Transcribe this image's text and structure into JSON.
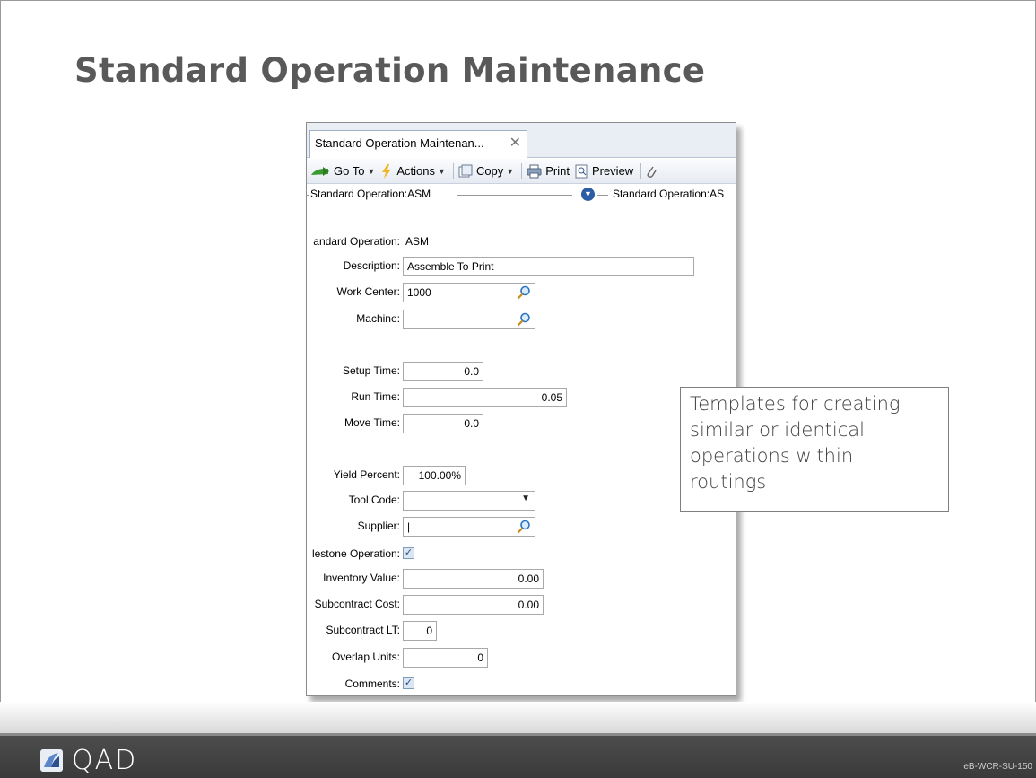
{
  "slide": {
    "title": "Standard Operation Maintenance",
    "callout": [
      "Templates for creating",
      "similar or identical",
      "operations within",
      "routings"
    ],
    "logo_text": "QAD",
    "slide_code": "eB-WCR-SU-150"
  },
  "window": {
    "tab_label": "Standard Operation Maintenan...",
    "tab_close": "✕",
    "toolbar": {
      "goto": "Go To",
      "actions": "Actions",
      "copy": "Copy",
      "print": "Print",
      "preview": "Preview"
    },
    "breadcrumb": {
      "left": "Standard Operation:ASM",
      "right": "Standard Operation:AS"
    }
  },
  "form": {
    "std_op": {
      "label": "andard Operation:",
      "value": "ASM"
    },
    "description": {
      "label": "Description:",
      "value": "Assemble To Print"
    },
    "work_center": {
      "label": "Work Center:",
      "value": "1000"
    },
    "machine": {
      "label": "Machine:",
      "value": ""
    },
    "setup_time": {
      "label": "Setup Time:",
      "value": "0.0"
    },
    "run_time": {
      "label": "Run Time:",
      "value": "0.05"
    },
    "move_time": {
      "label": "Move Time:",
      "value": "0.0"
    },
    "yield_percent": {
      "label": "Yield Percent:",
      "value": "100.00%"
    },
    "tool_code": {
      "label": "Tool Code:",
      "value": ""
    },
    "supplier": {
      "label": "Supplier:",
      "value": "|"
    },
    "milestone": {
      "label": "lestone Operation:",
      "checked": true
    },
    "inventory_value": {
      "label": "Inventory Value:",
      "value": "0.00"
    },
    "subcontract_cost": {
      "label": "Subcontract Cost:",
      "value": "0.00"
    },
    "subcontract_lt": {
      "label": "Subcontract LT:",
      "value": "0"
    },
    "overlap_units": {
      "label": "Overlap Units:",
      "value": "0"
    },
    "comments": {
      "label": "Comments:",
      "checked": true
    }
  },
  "colors": {
    "title": "#595959",
    "footer": "#3f3f3f",
    "accent": "#2a5da3"
  }
}
